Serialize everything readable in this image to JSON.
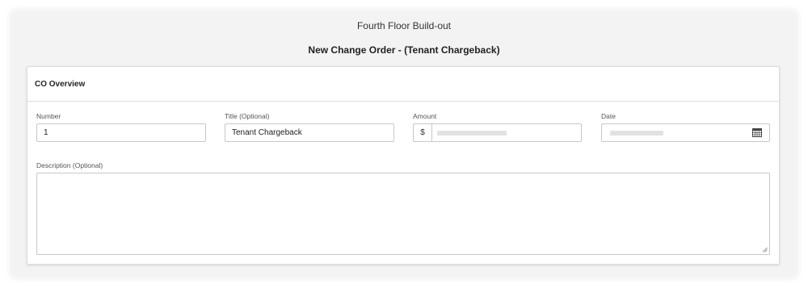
{
  "project": {
    "title": "Fourth Floor Build-out"
  },
  "page": {
    "title": "New Change Order - (Tenant Chargeback)"
  },
  "card": {
    "title": "CO Overview",
    "fields": {
      "number": {
        "label": "Number",
        "value": "1"
      },
      "title": {
        "label": "Title (Optional)",
        "value": "Tenant Chargeback"
      },
      "amount": {
        "label": "Amount",
        "currency_symbol": "$"
      },
      "date": {
        "label": "Date",
        "icon": "calendar-icon"
      },
      "description": {
        "label": "Description (Optional)",
        "value": ""
      }
    }
  },
  "colors": {
    "background": "#f3f3f3",
    "card": "#ffffff",
    "border": "#c8c8c8",
    "placeholder": "#e2e2e2"
  }
}
